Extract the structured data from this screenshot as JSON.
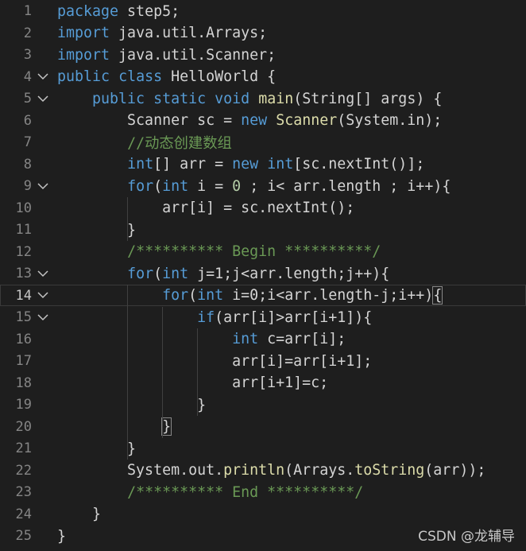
{
  "colors": {
    "background": "#1e1e1e",
    "keyword": "#569cd6",
    "type": "#4ec9b0",
    "function": "#dcdcaa",
    "number": "#b5cea8",
    "comment": "#6a9955",
    "text": "#d4d4d4",
    "line_number": "#858585"
  },
  "editor": {
    "current_line": 14,
    "lines": [
      {
        "n": "1",
        "fold": false,
        "tokens": [
          [
            "kw",
            "package"
          ],
          [
            "pl",
            " step5;"
          ]
        ]
      },
      {
        "n": "2",
        "fold": false,
        "tokens": [
          [
            "kw",
            "import"
          ],
          [
            "pl",
            " java.util.Arrays;"
          ]
        ]
      },
      {
        "n": "3",
        "fold": false,
        "tokens": [
          [
            "kw",
            "import"
          ],
          [
            "pl",
            " java.util.Scanner;"
          ]
        ]
      },
      {
        "n": "4",
        "fold": true,
        "tokens": [
          [
            "kw",
            "public"
          ],
          [
            "pl",
            " "
          ],
          [
            "kw",
            "class"
          ],
          [
            "pl",
            " HelloWorld {"
          ]
        ]
      },
      {
        "n": "5",
        "fold": true,
        "tokens": [
          [
            "pl",
            "    "
          ],
          [
            "kw",
            "public"
          ],
          [
            "pl",
            " "
          ],
          [
            "kw",
            "static"
          ],
          [
            "pl",
            " "
          ],
          [
            "kw",
            "void"
          ],
          [
            "pl",
            " "
          ],
          [
            "fn",
            "main"
          ],
          [
            "pl",
            "(String[] args) {"
          ]
        ]
      },
      {
        "n": "6",
        "fold": false,
        "tokens": [
          [
            "pl",
            "        Scanner sc = "
          ],
          [
            "kw",
            "new"
          ],
          [
            "pl",
            " "
          ],
          [
            "fn",
            "Scanner"
          ],
          [
            "pl",
            "(System.in);"
          ]
        ]
      },
      {
        "n": "7",
        "fold": false,
        "tokens": [
          [
            "pl",
            "        "
          ],
          [
            "cm",
            "//动态创建数组"
          ]
        ]
      },
      {
        "n": "8",
        "fold": false,
        "tokens": [
          [
            "pl",
            "        "
          ],
          [
            "kw",
            "int"
          ],
          [
            "pl",
            "[] arr = "
          ],
          [
            "kw",
            "new"
          ],
          [
            "pl",
            " "
          ],
          [
            "kw",
            "int"
          ],
          [
            "pl",
            "[sc.nextInt()];"
          ]
        ]
      },
      {
        "n": "9",
        "fold": true,
        "tokens": [
          [
            "pl",
            "        "
          ],
          [
            "kw",
            "for"
          ],
          [
            "pl",
            "("
          ],
          [
            "kw",
            "int"
          ],
          [
            "pl",
            " i = "
          ],
          [
            "num",
            "0"
          ],
          [
            "pl",
            " ; i< arr.length ; i++){"
          ]
        ]
      },
      {
        "n": "10",
        "fold": false,
        "tokens": [
          [
            "pl",
            "            arr[i] = sc.nextInt();"
          ]
        ]
      },
      {
        "n": "11",
        "fold": false,
        "tokens": [
          [
            "pl",
            "        }"
          ]
        ]
      },
      {
        "n": "12",
        "fold": false,
        "tokens": [
          [
            "pl",
            "        "
          ],
          [
            "cm",
            "/********** Begin **********/"
          ]
        ]
      },
      {
        "n": "13",
        "fold": true,
        "tokens": [
          [
            "pl",
            "        "
          ],
          [
            "kw",
            "for"
          ],
          [
            "pl",
            "("
          ],
          [
            "kw",
            "int"
          ],
          [
            "pl",
            " j=1;j<arr.length;j++){"
          ]
        ]
      },
      {
        "n": "14",
        "fold": true,
        "tokens": [
          [
            "pl",
            "            "
          ],
          [
            "kw",
            "for"
          ],
          [
            "pl",
            "("
          ],
          [
            "kw",
            "int"
          ],
          [
            "pl",
            " i=0;i<arr.length-j;i++)"
          ],
          [
            "br",
            "{"
          ]
        ]
      },
      {
        "n": "15",
        "fold": true,
        "tokens": [
          [
            "pl",
            "                "
          ],
          [
            "kw",
            "if"
          ],
          [
            "pl",
            "(arr[i]>arr[i+1]){"
          ]
        ]
      },
      {
        "n": "16",
        "fold": false,
        "tokens": [
          [
            "pl",
            "                    "
          ],
          [
            "kw",
            "int"
          ],
          [
            "pl",
            " c=arr[i];"
          ]
        ]
      },
      {
        "n": "17",
        "fold": false,
        "tokens": [
          [
            "pl",
            "                    arr[i]=arr[i+1];"
          ]
        ]
      },
      {
        "n": "18",
        "fold": false,
        "tokens": [
          [
            "pl",
            "                    arr[i+1]=c;"
          ]
        ]
      },
      {
        "n": "19",
        "fold": false,
        "tokens": [
          [
            "pl",
            "                }"
          ]
        ]
      },
      {
        "n": "20",
        "fold": false,
        "tokens": [
          [
            "pl",
            "            "
          ],
          [
            "br",
            "}"
          ]
        ]
      },
      {
        "n": "21",
        "fold": false,
        "tokens": [
          [
            "pl",
            "        }"
          ]
        ]
      },
      {
        "n": "22",
        "fold": false,
        "tokens": [
          [
            "pl",
            "        System.out."
          ],
          [
            "fn",
            "println"
          ],
          [
            "pl",
            "(Arrays."
          ],
          [
            "fn",
            "toString"
          ],
          [
            "pl",
            "(arr));"
          ]
        ]
      },
      {
        "n": "23",
        "fold": false,
        "tokens": [
          [
            "pl",
            "        "
          ],
          [
            "cm",
            "/********** End **********/"
          ]
        ]
      },
      {
        "n": "24",
        "fold": false,
        "tokens": [
          [
            "pl",
            "    }"
          ]
        ]
      },
      {
        "n": "25",
        "fold": false,
        "tokens": [
          [
            "pl",
            "}"
          ]
        ]
      }
    ]
  },
  "watermark": "CSDN @龙辅导"
}
